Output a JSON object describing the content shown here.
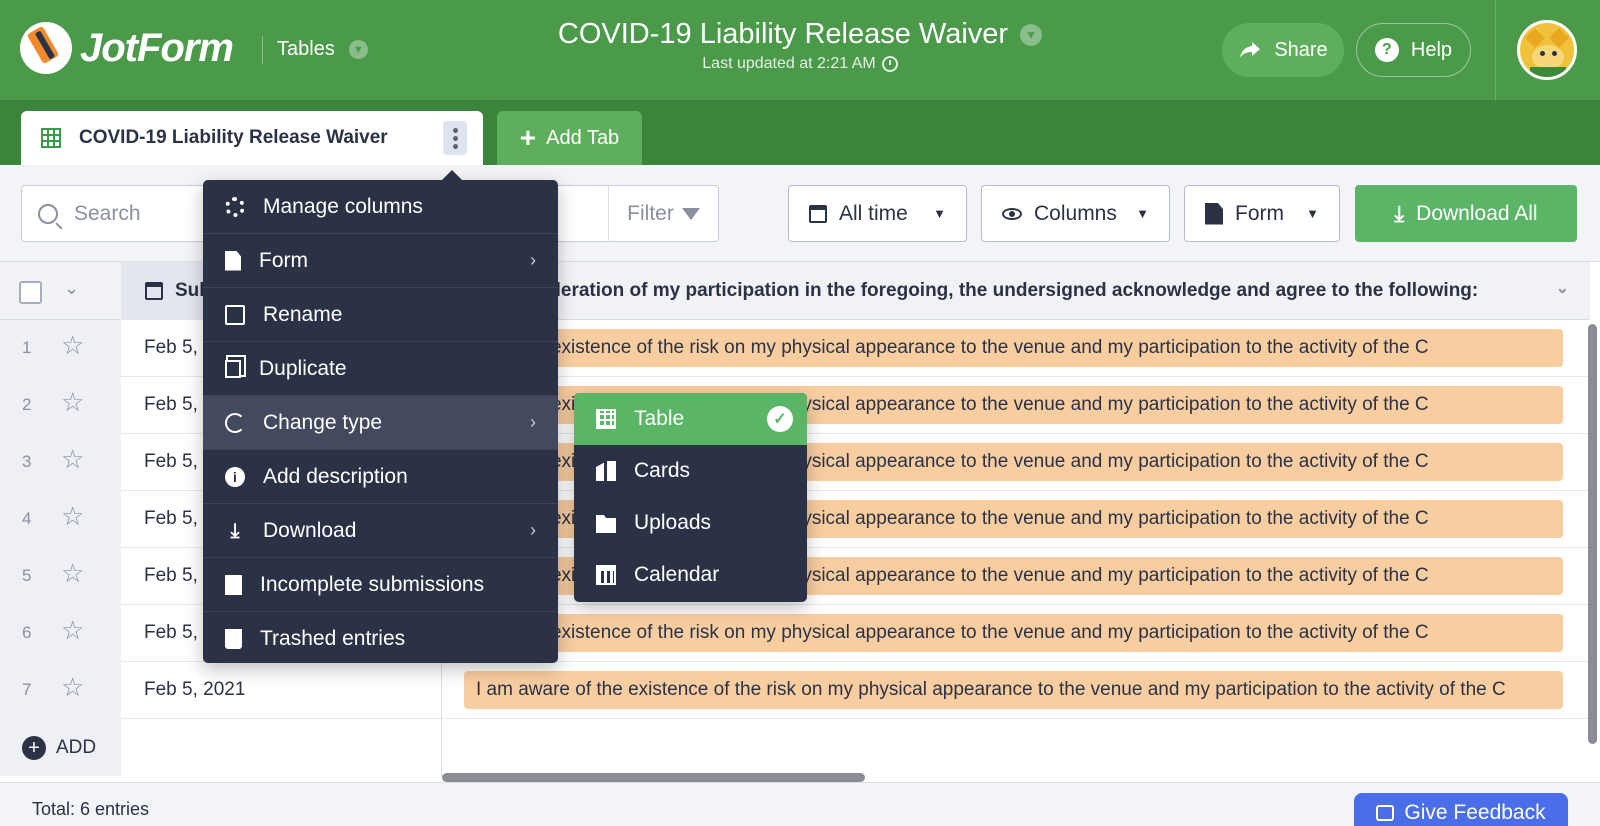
{
  "header": {
    "logo_text": "JotForm",
    "section_label": "Tables",
    "title": "COVID-19 Liability Release Waiver",
    "subtitle": "Last updated at 2:21 AM",
    "share_label": "Share",
    "help_label": "Help",
    "help_glyph": "?"
  },
  "tabs": {
    "active_label": "COVID-19 Liability Release Waiver",
    "add_tab_label": "Add Tab"
  },
  "toolbar": {
    "search_placeholder": "Search",
    "filter_label": "Filter",
    "date_range_label": "All time",
    "columns_label": "Columns",
    "form_label": "Form",
    "download_all_label": "Download All"
  },
  "table": {
    "header_col1": "Sub",
    "header_col2": "ideration of my participation in the foregoing, the undersigned acknowledge and agree to the following:",
    "rows": [
      {
        "num": "1",
        "date": "Feb 5,",
        "text": "re of the existence of the risk on my physical appearance to the venue and my participation to the activity of the C"
      },
      {
        "num": "2",
        "date": "Feb 5,",
        "text": "re of the existence of the risk on my physical appearance to the venue and my participation to the activity of the C"
      },
      {
        "num": "3",
        "date": "Feb 5,",
        "text": "re of the existence of the risk on my physical appearance to the venue and my participation to the activity of the C"
      },
      {
        "num": "4",
        "date": "Feb 5,",
        "text": "re of the existence of the risk on my physical appearance to the venue and my participation to the activity of the C"
      },
      {
        "num": "5",
        "date": "Feb 5,",
        "text": "re of the existence of the risk on my physical appearance to the venue and my participation to the activity of the C"
      },
      {
        "num": "6",
        "date": "Feb 5,",
        "text": "re of the existence of the risk on my physical appearance to the venue and my participation to the activity of the C"
      },
      {
        "num": "7",
        "date": "Feb 5, 2021",
        "text": "I am aware of the existence of the risk on my physical appearance to the venue and my participation to the activity of the C"
      }
    ],
    "add_label": "ADD"
  },
  "footer": {
    "total_label": "Total: 6 entries",
    "feedback_label": "Give Feedback"
  },
  "menu": {
    "items": [
      {
        "label": "Manage columns"
      },
      {
        "label": "Form"
      },
      {
        "label": "Rename"
      },
      {
        "label": "Duplicate"
      },
      {
        "label": "Change type"
      },
      {
        "label": "Add description"
      },
      {
        "label": "Download"
      },
      {
        "label": "Incomplete submissions"
      },
      {
        "label": "Trashed entries"
      }
    ]
  },
  "submenu": {
    "items": [
      {
        "label": "Table"
      },
      {
        "label": "Cards"
      },
      {
        "label": "Uploads"
      },
      {
        "label": "Calendar"
      }
    ]
  },
  "colors": {
    "header_green": "#4a9a4a",
    "tabbar_green": "#3a843c",
    "accent_green": "#5ab566",
    "menu_dark": "#2b3245",
    "tag_orange": "#f8cda0",
    "feedback_blue": "#4a6ee8"
  }
}
